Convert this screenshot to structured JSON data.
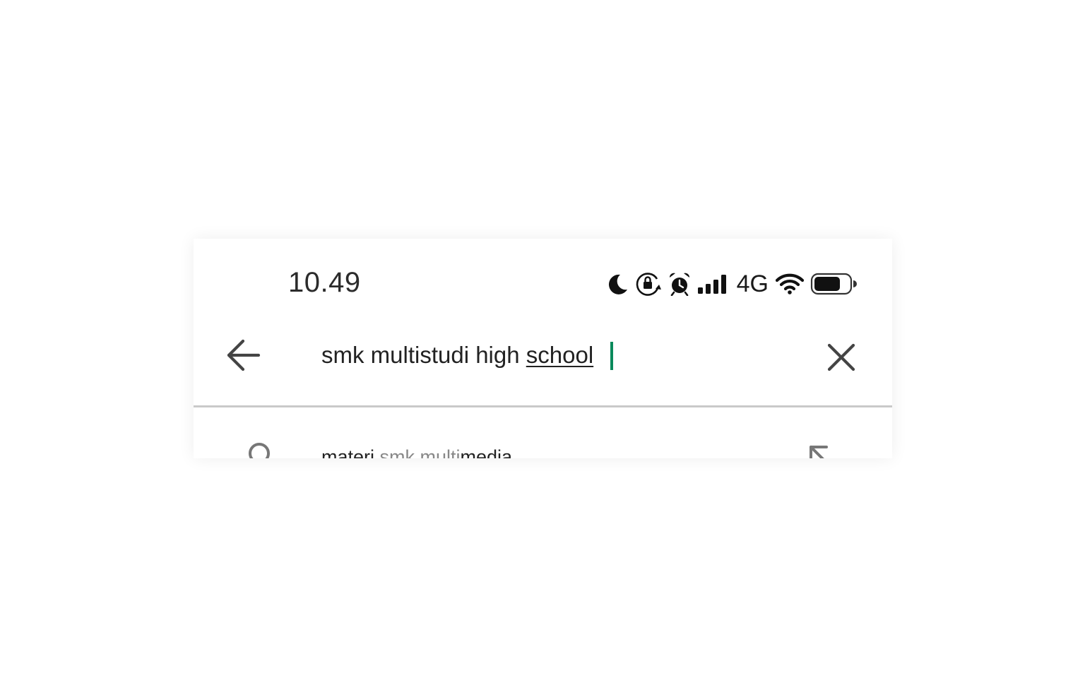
{
  "status_bar": {
    "time": "10.49",
    "network": "4G",
    "icons": [
      "moon-icon",
      "rotation-lock-icon",
      "alarm-icon",
      "signal-bars-icon",
      "wifi-icon",
      "battery-icon"
    ],
    "battery_level": 0.75
  },
  "search": {
    "query_prefix": "smk multistudi high ",
    "query_composing": "school",
    "caret_color": "#0a8a5c",
    "back_icon": "arrow-left-icon",
    "clear_icon": "close-icon"
  },
  "suggestions": [
    {
      "parts": [
        {
          "text": "materi ",
          "style": "dark"
        },
        {
          "text": "smk multi",
          "style": "light"
        },
        {
          "text": "media",
          "style": "dark"
        }
      ],
      "icon": "search-icon",
      "action_icon": "arrow-up-left-icon"
    }
  ]
}
